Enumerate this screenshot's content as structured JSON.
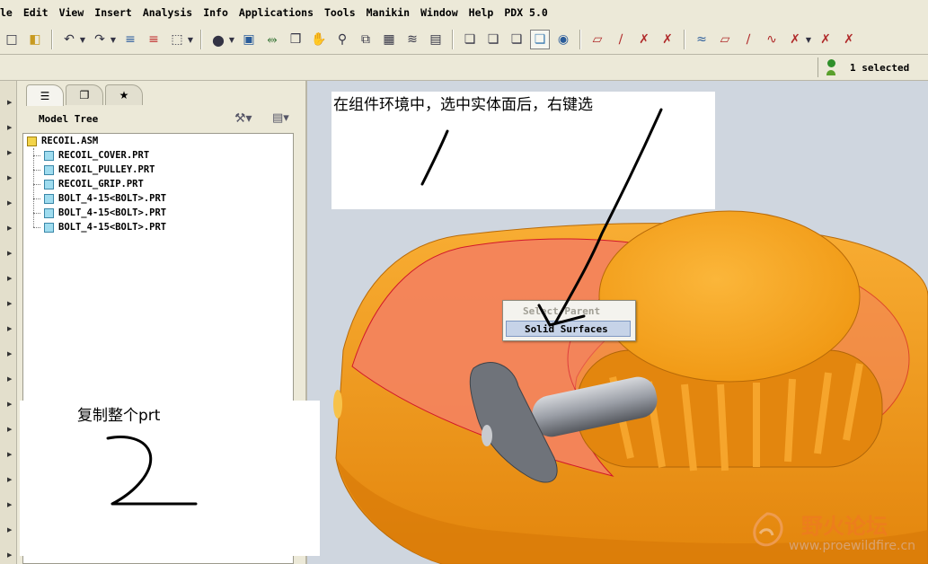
{
  "menu": {
    "items": [
      "le",
      "Edit",
      "View",
      "Insert",
      "Analysis",
      "Info",
      "Applications",
      "Tools",
      "Manikin",
      "Window",
      "Help",
      "PDX 5.0"
    ]
  },
  "toolbar": {
    "icons": [
      "new-icon",
      "open-icon",
      "undo-icon",
      "redo-icon",
      "regenerate-icon",
      "regen-manager-icon",
      "select-box-icon",
      "sphere-shading-icon",
      "sketch-view-icon",
      "datum-axis-icon",
      "appearance-icon",
      "pan-icon",
      "zoom-icon",
      "insert-component-icon",
      "view-manager-icon",
      "layers-icon",
      "saved-views-icon",
      "wireframe-icon",
      "hidden-line-icon",
      "no-hidden-icon",
      "shading-icon",
      "spin-center-icon",
      "datum-plane-icon",
      "axis-display-icon",
      "point-display-icon",
      "csys-display-icon",
      "curve-icon",
      "plane-icon",
      "line-icon",
      "spline-icon",
      "point-icon",
      "csys-icon",
      "more-icon"
    ]
  },
  "status": {
    "selected_text": "1 selected"
  },
  "navigator": {
    "tabs": [
      "model-tree-tab",
      "folder-browser-tab",
      "favorites-tab"
    ],
    "title": "Model Tree",
    "settings_icon": "tree-settings-icon",
    "show_icon": "tree-show-icon",
    "root": "RECOIL.ASM",
    "items": [
      "RECOIL_COVER.PRT",
      "RECOIL_PULLEY.PRT",
      "RECOIL_GRIP.PRT",
      "BOLT_4-15<BOLT>.PRT",
      "BOLT_4-15<BOLT>.PRT",
      "BOLT_4-15<BOLT>.PRT"
    ]
  },
  "annotations": {
    "note1": "在组件环境中，选中实体面后，右键选",
    "note2": "复制整个prt"
  },
  "context_menu": {
    "items": [
      "Select Parent",
      "Solid Surfaces"
    ],
    "highlighted": "Solid Surfaces"
  },
  "watermark": {
    "title": "野火论坛",
    "url": "www.proewildfire.cn"
  },
  "colors": {
    "model_orange": "#f59a14",
    "selected_surface": "#f4845c",
    "highlight_edge": "#d0102a",
    "viewport_bg": "#cfd6df"
  }
}
